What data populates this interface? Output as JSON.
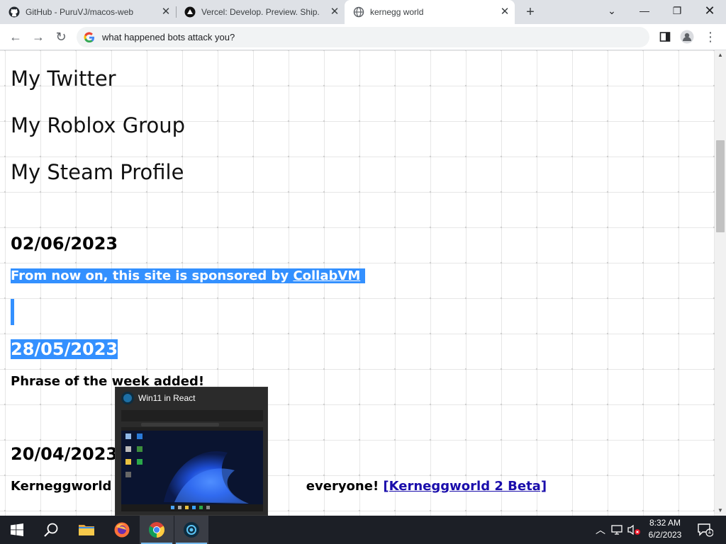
{
  "browser": {
    "tabs": [
      {
        "title": "GitHub - PuruVJ/macos-web",
        "icon": "github-icon",
        "active": false
      },
      {
        "title": "Vercel: Develop. Preview. Ship. For",
        "icon": "vercel-icon",
        "active": false
      },
      {
        "title": "kernegg world",
        "icon": "globe-icon",
        "active": true
      }
    ],
    "new_tab_label": "+",
    "address_bar": {
      "value": "what happened bots attack you?",
      "icon": "google-icon"
    }
  },
  "page": {
    "links": [
      "My Twitter",
      "My Roblox Group",
      "My Steam Profile"
    ],
    "posts": [
      {
        "date": "02/06/2023",
        "text": "From now on, this site is sponsored by ",
        "link": "CollabVM"
      },
      {
        "date": "28/05/2023",
        "text": "Phrase of the week added!"
      },
      {
        "date": "20/04/2023",
        "text_before": "Kerneggworld 2",
        "text_after": "everyone! ",
        "link": "[Kerneggworld 2 Beta]"
      }
    ]
  },
  "taskbar_preview": {
    "title": "Win11 in React"
  },
  "taskbar": {
    "apps": [
      "start-icon",
      "search-icon",
      "file-explorer-icon",
      "firefox-icon",
      "chrome-icon",
      "win11-react-icon"
    ],
    "clock_time": "8:32 AM",
    "clock_date": "6/2/2023",
    "notification_count": "1"
  },
  "colors": {
    "selection": "#3390ff",
    "link": "#1a0dab",
    "taskbar": "#1c1f26"
  }
}
